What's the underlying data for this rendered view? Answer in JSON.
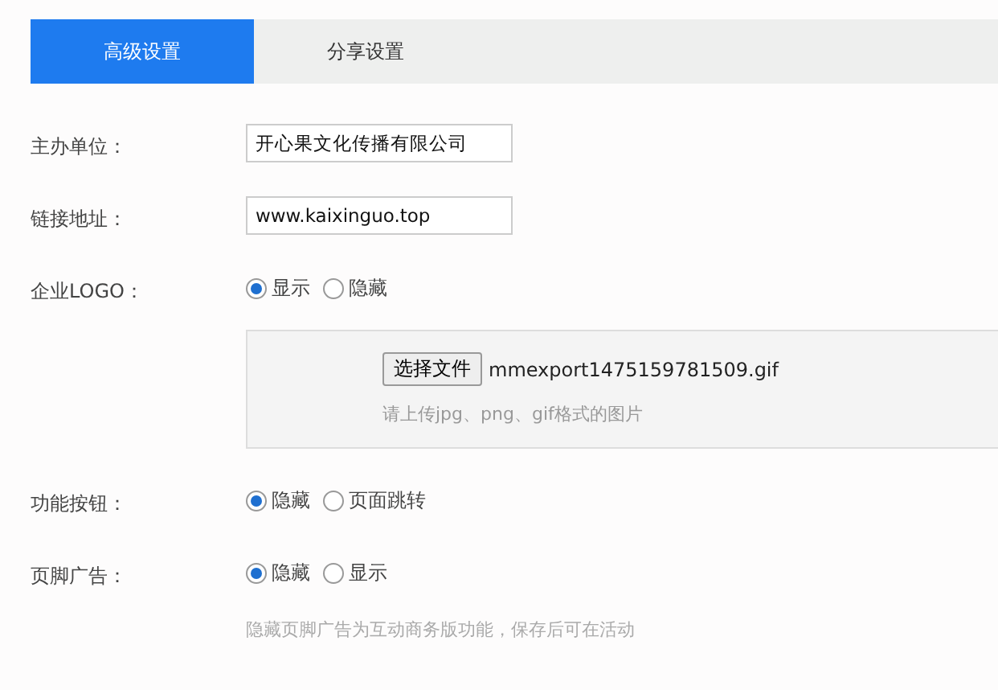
{
  "tabs": [
    {
      "label": "高级设置",
      "selected": true
    },
    {
      "label": "分享设置",
      "selected": false
    }
  ],
  "fields": [
    {
      "kind": "text",
      "label": "主办单位：",
      "value": "开心果文化传播有限公司"
    },
    {
      "kind": "text",
      "label": "链接地址：",
      "value": "www.kaixinguo.top"
    },
    {
      "kind": "radio",
      "label": "企业LOGO：",
      "options": [
        {
          "label": "显示",
          "selected": true
        },
        {
          "label": "隐藏",
          "selected": false
        }
      ],
      "upload": {
        "button": "选择文件",
        "file": "mmexport1475159781509.gif",
        "hint": "请上传jpg、png、gif格式的图片"
      }
    },
    {
      "kind": "radio",
      "label": "功能按钮：",
      "options": [
        {
          "label": "隐藏",
          "selected": true
        },
        {
          "label": "页面跳转",
          "selected": false
        }
      ]
    },
    {
      "kind": "radio",
      "label": "页脚广告：",
      "options": [
        {
          "label": "隐藏",
          "selected": true
        },
        {
          "label": "显示",
          "selected": false
        }
      ],
      "note": "隐藏页脚广告为互动商务版功能，保存后可在活动"
    }
  ]
}
